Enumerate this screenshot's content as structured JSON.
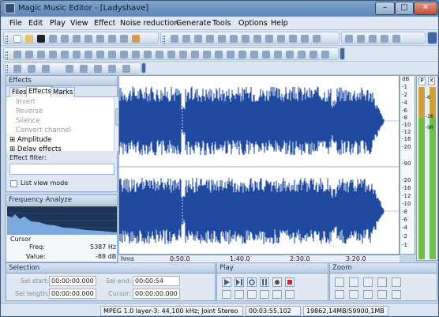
{
  "window": {
    "title": "Magic Music Editor - [Ladyshave]"
  },
  "menu": [
    "File",
    "Edit",
    "Play",
    "View",
    "Effect",
    "Noise reduction",
    "Generate",
    "Tools",
    "Options",
    "Help"
  ],
  "effects_panel": {
    "title": "Effects",
    "tabs": [
      "Files",
      "Effects",
      "Marks"
    ],
    "items": [
      "Invert",
      "Reverse",
      "Silence",
      "Convert channel",
      "Amplitude",
      "Delay effects"
    ],
    "filter_label": "Effect filter:",
    "list_view_label": "List view mode"
  },
  "freq_panel": {
    "title": "Frequency Analyze",
    "cursor_label": "Cursor",
    "freq_label": "Freq:",
    "freq_value": "5387 Hz",
    "value_label": "Value:",
    "value_value": "-88 dB"
  },
  "db_scale": {
    "unit": "dB",
    "ticks": [
      "-1",
      "-2",
      "-4",
      "-6",
      "-8",
      "-10",
      "-12",
      "-16",
      "-20",
      "-90",
      "-20",
      "-16",
      "-12",
      "-10",
      "-8",
      "-6",
      "-4",
      "-2",
      "-1"
    ]
  },
  "meter": {
    "labels": [
      "P",
      "X"
    ],
    "scale": [
      "-6",
      "-16",
      "-90"
    ],
    "level": 0.18
  },
  "ruler": {
    "ticks": [
      "hms",
      "0:50.0",
      "1:40.0",
      "2:30.0",
      "3:20.0"
    ]
  },
  "selection": {
    "title": "Selection",
    "sel_start_label": "Sel start:",
    "sel_start": "00:00:00.000",
    "sel_end_label": "Sel end:",
    "sel_end": "00:00:54",
    "sel_length_label": "Sel length:",
    "sel_length": "00:00:00.000",
    "cursor_label": "Cursor:",
    "cursor": "00:00:00.000"
  },
  "play": {
    "title": "Play"
  },
  "zoom": {
    "title": "Zoom"
  },
  "status": {
    "format": "MPEG 1.0 layer-3: 44,100 kHz; Joint Stereo",
    "duration": "00:03:55.102",
    "memory": "19862,14MB/59900,1MB"
  }
}
